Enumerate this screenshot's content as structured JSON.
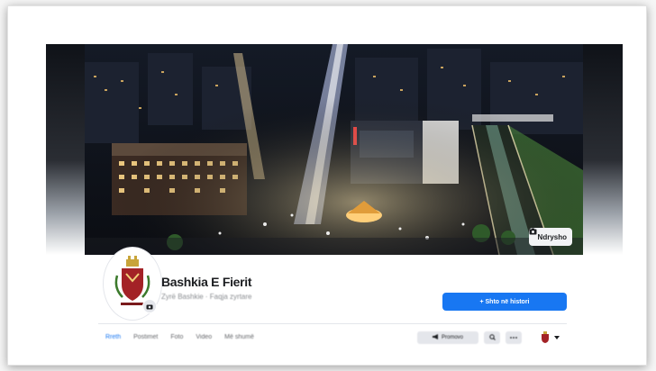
{
  "page": {
    "name": "Bashkia E Fierit",
    "subtitle": "Zyrë Bashkie · Faqja zyrtare",
    "primary_action": "+ Shto në histori",
    "cover_button": "Ndrysho"
  },
  "tabs": [
    {
      "label": "Rreth",
      "active": true
    },
    {
      "label": "Postimet",
      "active": false
    },
    {
      "label": "Foto",
      "active": false
    },
    {
      "label": "Video",
      "active": false
    },
    {
      "label": "Më shumë",
      "active": false
    }
  ],
  "tab_actions": {
    "promote": "Promovo",
    "search_icon": "search-icon",
    "more_icon": "more-icon"
  },
  "colors": {
    "brand": "#1877f2",
    "background": "#ffffff",
    "muted": "#65676b"
  }
}
